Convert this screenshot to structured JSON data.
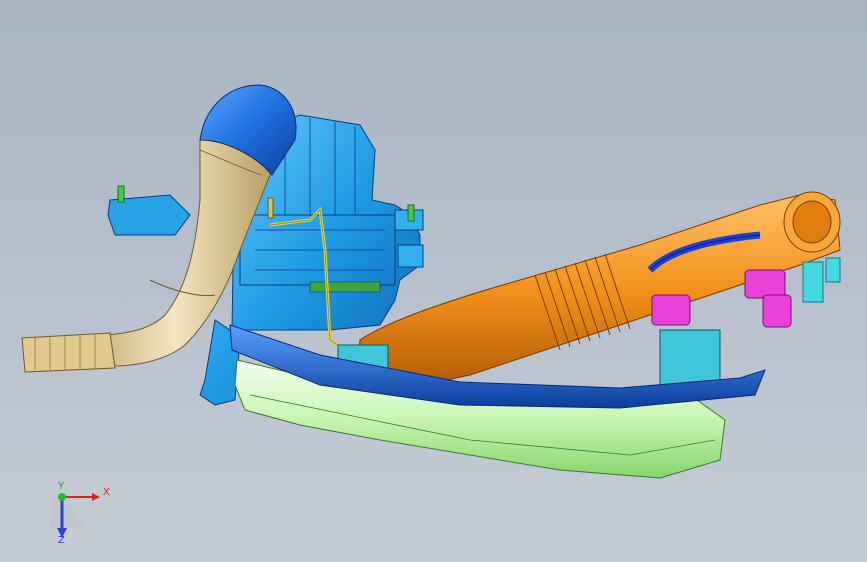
{
  "viewport": {
    "background_top": "#a9b4c3",
    "background_bottom": "#c6cdd6"
  },
  "parts": [
    {
      "id": "air-duct",
      "color": "#e6d3a8"
    },
    {
      "id": "duct-elbow-cap",
      "color": "#2e7fe0"
    },
    {
      "id": "housing",
      "color": "#27a4e8"
    },
    {
      "id": "intake-pipe",
      "color": "#f39a1e"
    },
    {
      "id": "cover-tray",
      "color": "#bff2a8"
    },
    {
      "id": "blue-rail",
      "color": "#1f6fe0"
    },
    {
      "id": "connector",
      "color": "#e840d8"
    },
    {
      "id": "fitting",
      "color": "#44d8e0"
    },
    {
      "id": "yellow-wire",
      "color": "#f0e060"
    }
  ],
  "triad": {
    "x_label": "X",
    "y_label": "Y",
    "z_label": "Z",
    "x_color": "#e02020",
    "y_color": "#20c020",
    "z_color": "#3040d0"
  }
}
